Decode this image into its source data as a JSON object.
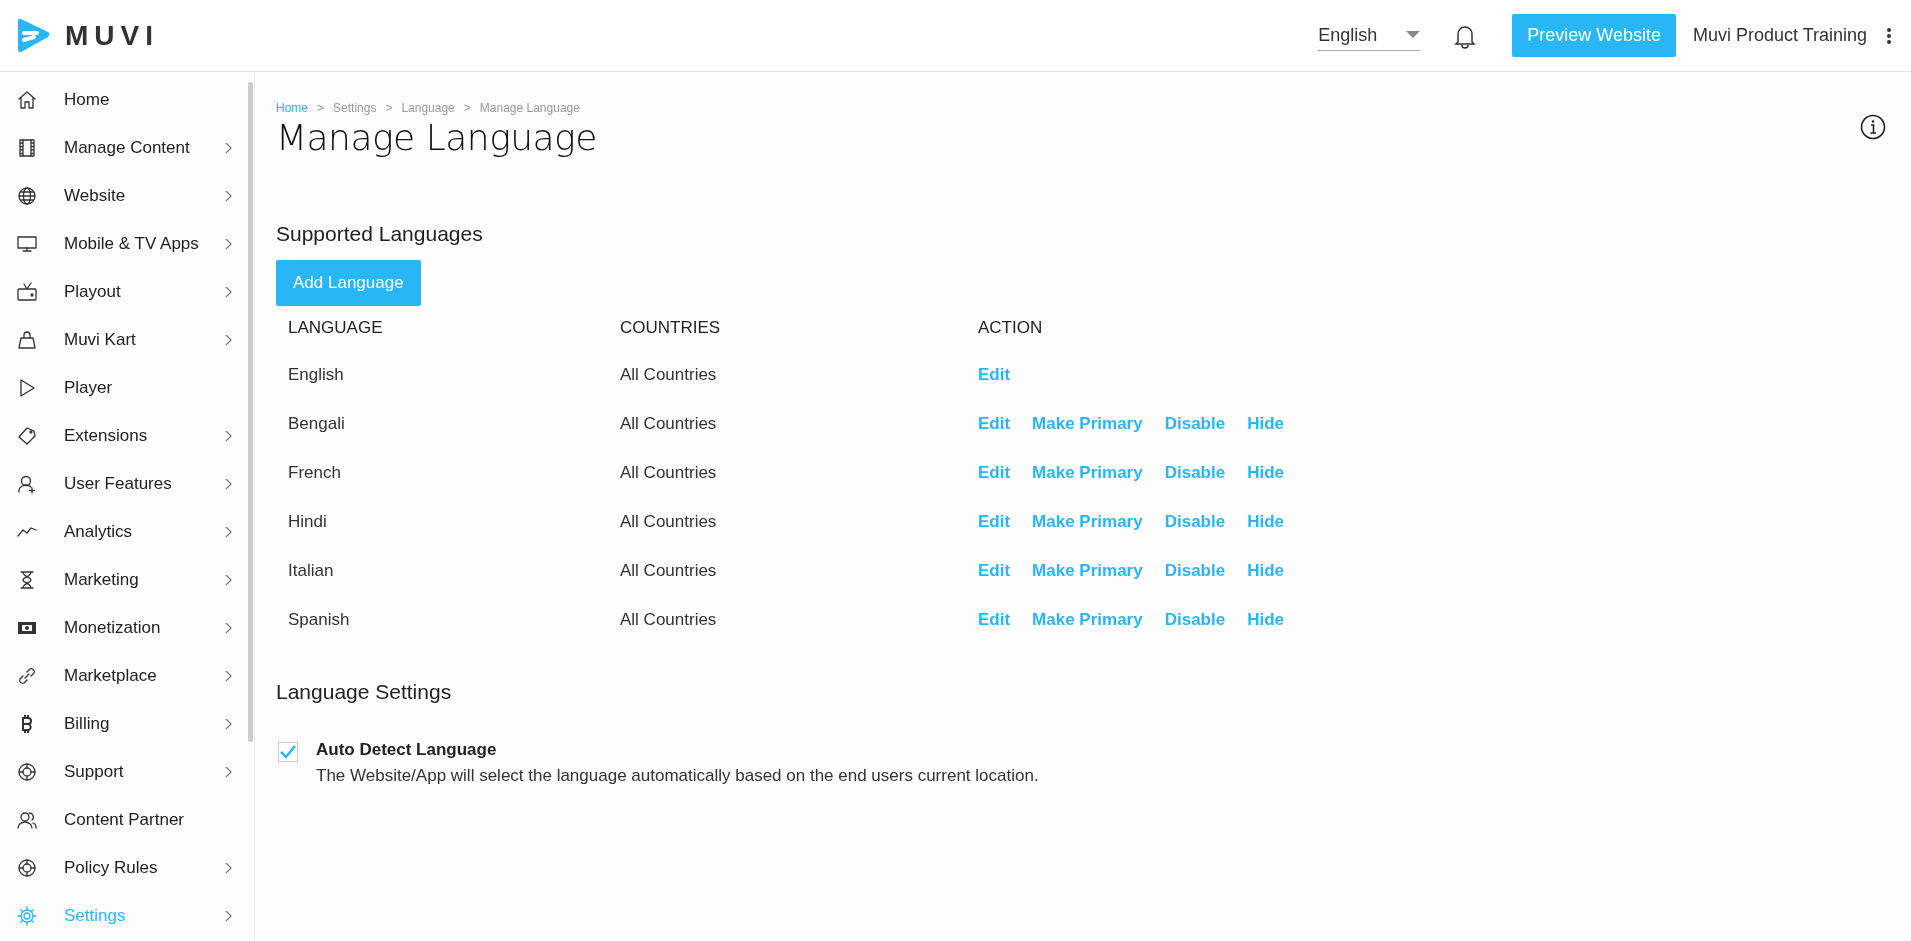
{
  "header": {
    "logo_text": "MUVI",
    "language_select": {
      "value": "English"
    },
    "preview_button": "Preview Website",
    "account_name": "Muvi Product Training"
  },
  "sidebar": {
    "items": [
      {
        "label": "Home",
        "has_submenu": false,
        "selected": false
      },
      {
        "label": "Manage Content",
        "has_submenu": true,
        "selected": false
      },
      {
        "label": "Website",
        "has_submenu": true,
        "selected": false
      },
      {
        "label": "Mobile & TV Apps",
        "has_submenu": true,
        "selected": false
      },
      {
        "label": "Playout",
        "has_submenu": true,
        "selected": false
      },
      {
        "label": "Muvi Kart",
        "has_submenu": true,
        "selected": false
      },
      {
        "label": "Player",
        "has_submenu": false,
        "selected": false
      },
      {
        "label": "Extensions",
        "has_submenu": true,
        "selected": false
      },
      {
        "label": "User Features",
        "has_submenu": true,
        "selected": false
      },
      {
        "label": "Analytics",
        "has_submenu": true,
        "selected": false
      },
      {
        "label": "Marketing",
        "has_submenu": true,
        "selected": false
      },
      {
        "label": "Monetization",
        "has_submenu": true,
        "selected": false
      },
      {
        "label": "Marketplace",
        "has_submenu": true,
        "selected": false
      },
      {
        "label": "Billing",
        "has_submenu": true,
        "selected": false
      },
      {
        "label": "Support",
        "has_submenu": true,
        "selected": false
      },
      {
        "label": "Content Partner",
        "has_submenu": false,
        "selected": false
      },
      {
        "label": "Policy Rules",
        "has_submenu": true,
        "selected": false
      },
      {
        "label": "Settings",
        "has_submenu": true,
        "selected": true
      }
    ]
  },
  "breadcrumb": [
    {
      "label": "Home",
      "link": true
    },
    {
      "label": "Settings",
      "link": false
    },
    {
      "label": "Language",
      "link": false
    },
    {
      "label": "Manage Language",
      "link": false
    }
  ],
  "breadcrumb_separator": ">",
  "page_title": "Manage Language",
  "supported_languages": {
    "heading": "Supported Languages",
    "add_button": "Add Language",
    "table": {
      "columns": [
        "LANGUAGE",
        "COUNTRIES",
        "ACTION"
      ],
      "rows": [
        {
          "language": "English",
          "countries": "All Countries",
          "actions": [
            "Edit"
          ]
        },
        {
          "language": "Bengali",
          "countries": "All Countries",
          "actions": [
            "Edit",
            "Make Primary",
            "Disable",
            "Hide"
          ]
        },
        {
          "language": "French",
          "countries": "All Countries",
          "actions": [
            "Edit",
            "Make Primary",
            "Disable",
            "Hide"
          ]
        },
        {
          "language": "Hindi",
          "countries": "All Countries",
          "actions": [
            "Edit",
            "Make Primary",
            "Disable",
            "Hide"
          ]
        },
        {
          "language": "Italian",
          "countries": "All Countries",
          "actions": [
            "Edit",
            "Make Primary",
            "Disable",
            "Hide"
          ]
        },
        {
          "language": "Spanish",
          "countries": "All Countries",
          "actions": [
            "Edit",
            "Make Primary",
            "Disable",
            "Hide"
          ]
        }
      ]
    }
  },
  "language_settings": {
    "heading": "Language Settings",
    "auto_detect": {
      "label": "Auto Detect Language",
      "checked": true,
      "description": "The Website/App will select the language automatically based on the end users current location."
    }
  }
}
